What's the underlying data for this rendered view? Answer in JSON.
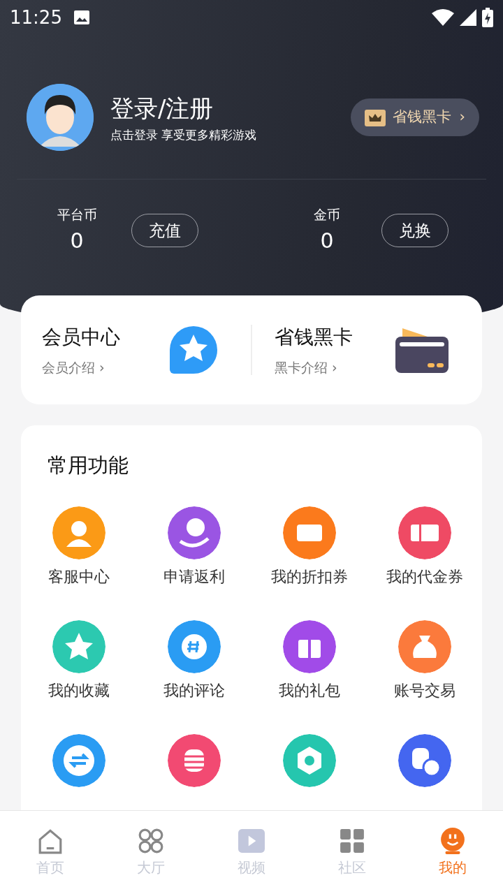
{
  "status_bar": {
    "time": "11:25"
  },
  "profile": {
    "title": "登录/注册",
    "subtitle": "点击登录  享受更多精彩游戏",
    "vip_button": "省钱黑卡",
    "vip_chevron": "›"
  },
  "balances": [
    {
      "label": "平台币",
      "value": "0",
      "action": "充值"
    },
    {
      "label": "金币",
      "value": "0",
      "action": "兑换"
    }
  ],
  "promo_cards": [
    {
      "title": "会员中心",
      "link": "会员介绍",
      "chevron": "›"
    },
    {
      "title": "省钱黑卡",
      "link": "黑卡介绍",
      "chevron": "›"
    }
  ],
  "functions": {
    "title": "常用功能",
    "items": [
      {
        "kind": "labeled",
        "label": "客服中心"
      },
      {
        "kind": "labeled",
        "label": "申请返利"
      },
      {
        "kind": "labeled",
        "label": "我的折扣券"
      },
      {
        "kind": "labeled",
        "label": "我的代金券"
      },
      {
        "kind": "labeled",
        "label": "我的收藏"
      },
      {
        "kind": "labeled",
        "label": "我的评论"
      },
      {
        "kind": "labeled",
        "label": "我的礼包"
      },
      {
        "kind": "labeled",
        "label": "账号交易"
      },
      {
        "kind": "icon"
      },
      {
        "kind": "icon"
      },
      {
        "kind": "icon"
      },
      {
        "kind": "icon"
      }
    ]
  },
  "tab_bar": [
    {
      "label": "首页",
      "selected": false
    },
    {
      "label": "大厅",
      "selected": false
    },
    {
      "label": "视频",
      "selected": false
    },
    {
      "label": "社区",
      "selected": false
    },
    {
      "label": "我的",
      "selected": true
    }
  ]
}
